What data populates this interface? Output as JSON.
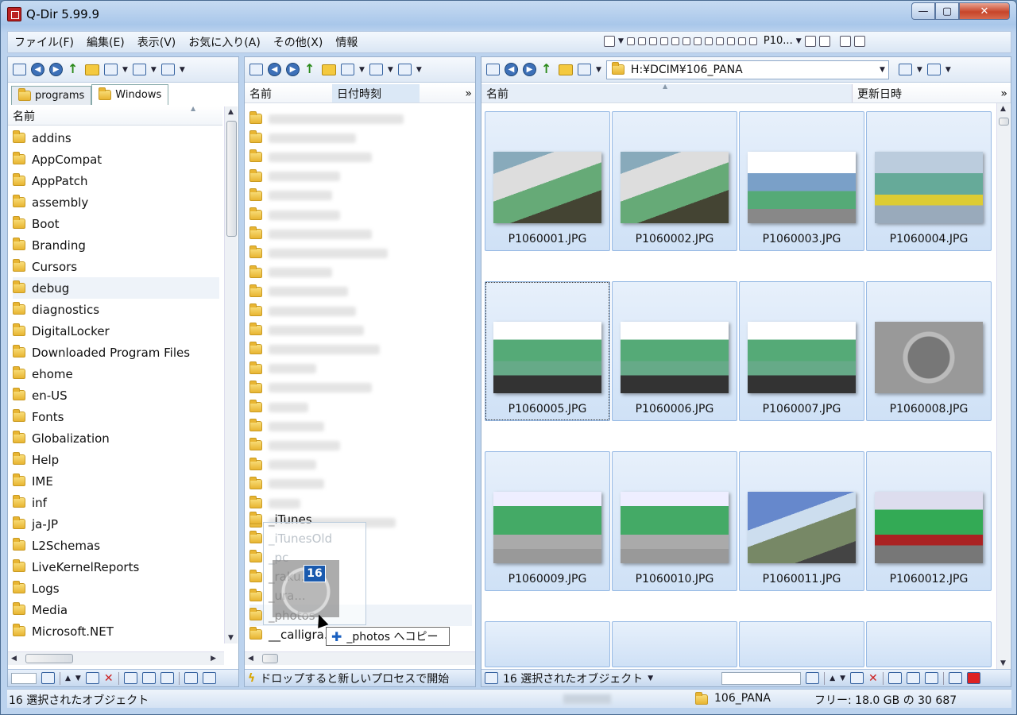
{
  "window": {
    "title": "Q-Dir 5.99.9",
    "min": "—",
    "max": "▢",
    "close": "✕"
  },
  "menu": {
    "items": [
      "ファイル(F)",
      "編集(E)",
      "表示(V)",
      "お気に入り(A)",
      "その他(X)",
      "情報"
    ],
    "favorite": "P10..."
  },
  "left": {
    "tabs": [
      "programs",
      "Windows"
    ],
    "column": "名前",
    "folders": [
      "addins",
      "AppCompat",
      "AppPatch",
      "assembly",
      "Boot",
      "Branding",
      "Cursors",
      "debug",
      "diagnostics",
      "DigitalLocker",
      "Downloaded Program Files",
      "ehome",
      "en-US",
      "Fonts",
      "Globalization",
      "Help",
      "IME",
      "inf",
      "ja-JP",
      "L2Schemas",
      "LiveKernelReports",
      "Logs",
      "Media",
      "Microsoft.NET"
    ],
    "selected_index": 7
  },
  "middle": {
    "columns": [
      "名前",
      "日付時刻"
    ],
    "visible_folders": [
      "_iTunes",
      "_iTunesOld",
      "_pc",
      "_raku...",
      "_ura...",
      "_photos",
      "__calligra..."
    ],
    "bottom_text": "ドロップすると新しいプロセスで開始"
  },
  "right": {
    "address": "H:¥DCIM¥106_PANA",
    "columns": [
      "名前",
      "更新日時"
    ],
    "files": [
      "P1060001.JPG",
      "P1060002.JPG",
      "P1060003.JPG",
      "P1060004.JPG",
      "P1060005.JPG",
      "P1060006.JPG",
      "P1060007.JPG",
      "P1060008.JPG",
      "P1060009.JPG",
      "P1060010.JPG",
      "P1060011.JPG",
      "P1060012.JPG"
    ],
    "selection_text": "16 選択されたオブジェクト"
  },
  "drag": {
    "count": "16",
    "tooltip": "_photos へコピー"
  },
  "status": {
    "selection": "16 選択されたオブジェクト",
    "folder": "106_PANA",
    "free": "フリー: 18.0 GB の 30 687"
  }
}
